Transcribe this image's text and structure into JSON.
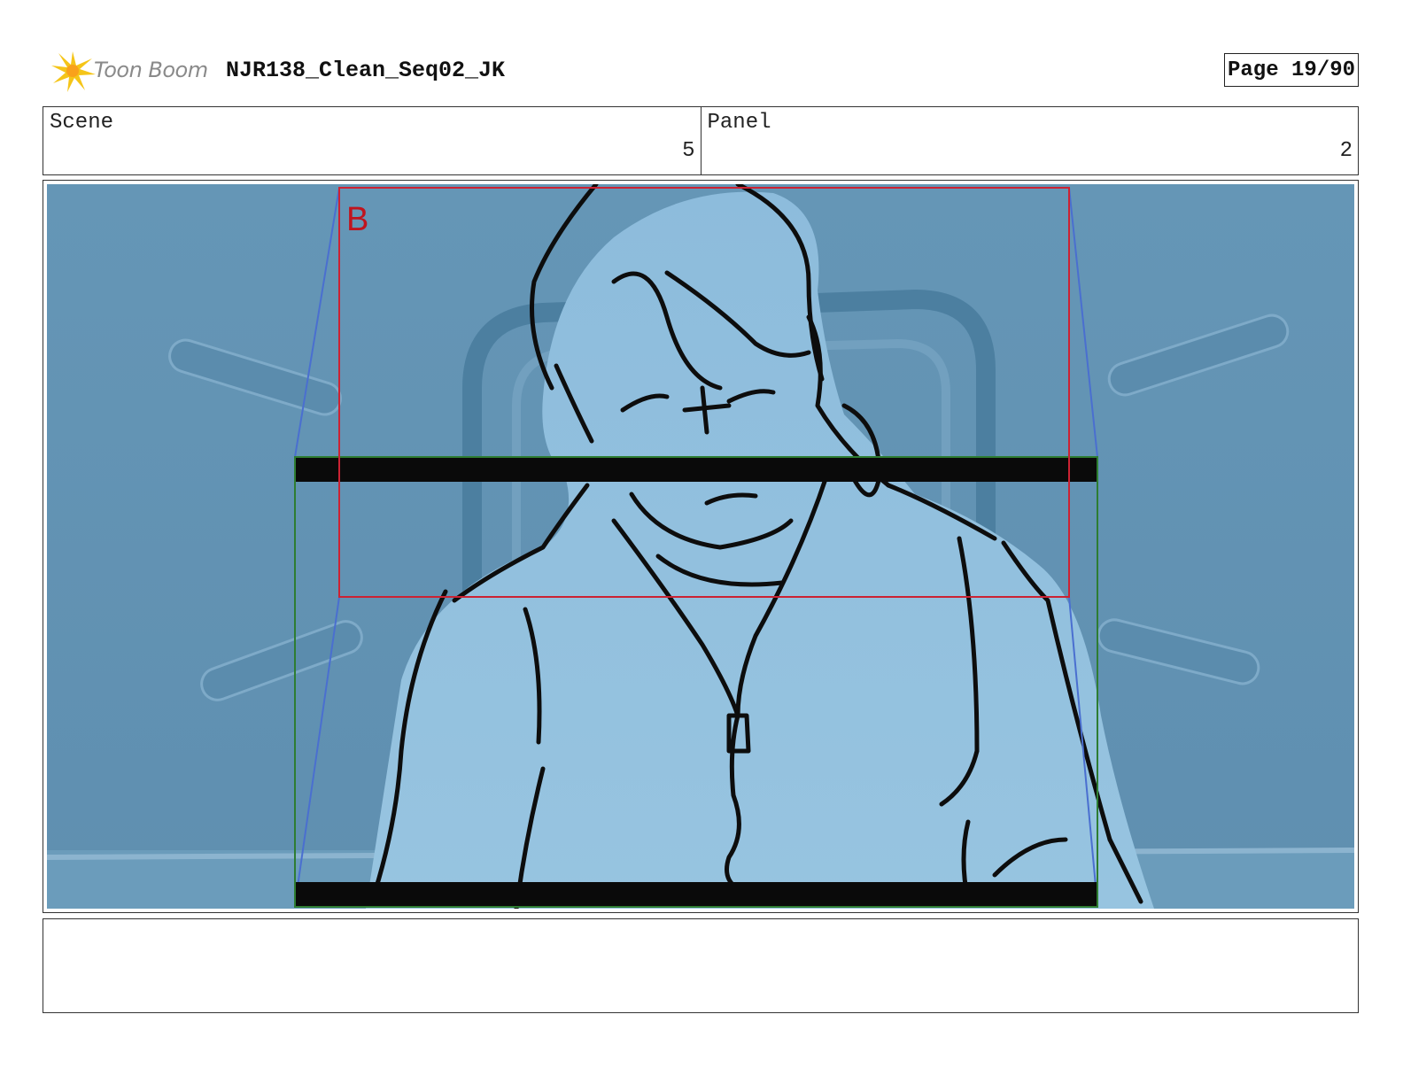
{
  "header": {
    "brand": "Toon Boom",
    "title": "NJR138_Clean_Seq02_JK",
    "page": "Page 19/90"
  },
  "info": {
    "scene_label": "Scene",
    "scene_value": "5",
    "panel_label": "Panel",
    "panel_value": "2"
  },
  "panel": {
    "frame_marker": "B",
    "colors": {
      "background": "#6596b6",
      "figure": "#8fbddc",
      "camera_frame_red": "#cc2233",
      "camera_frame_green": "#2e7d32",
      "motion_path_blue": "#4a6fd0"
    }
  },
  "notes": {
    "text": ""
  }
}
